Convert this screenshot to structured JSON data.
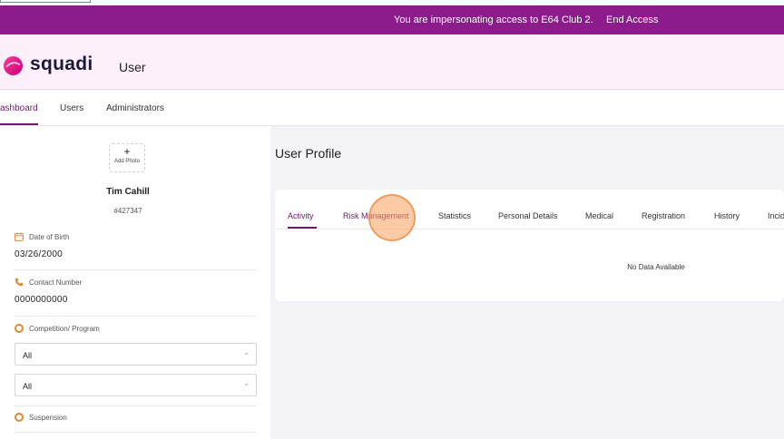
{
  "impersonation": {
    "message": "You are impersonating access to E64 Club 2.",
    "end_label": "End Access"
  },
  "header": {
    "logo_text": "squadi",
    "title": "User"
  },
  "nav": {
    "tabs": [
      {
        "label": "ashboard",
        "active": true
      },
      {
        "label": "Users"
      },
      {
        "label": "Administrators"
      }
    ]
  },
  "sidebar": {
    "add_photo_plus": "+",
    "add_photo_label": "Add Photo",
    "name": "Tim Cahill",
    "user_id": "#427347",
    "dob_label": "Date of Birth",
    "dob_value": "03/26/2000",
    "contact_label": "Contact Number",
    "contact_value": "0000000000",
    "competition_label": "Competition/ Program",
    "select1_value": "All",
    "select2_value": "All",
    "suspension_label": "Suspension"
  },
  "main": {
    "title": "User Profile",
    "tabs": [
      "Activity",
      "Risk Management",
      "Statistics",
      "Personal Details",
      "Medical",
      "Registration",
      "History",
      "Incid"
    ],
    "active_tab": "Activity",
    "no_data": "No Data Available"
  },
  "colors": {
    "brand_purple": "#8c1b8b",
    "accent_orange": "#e08a2e"
  }
}
